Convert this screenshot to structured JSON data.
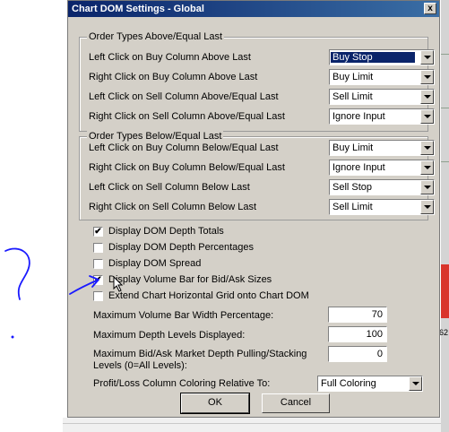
{
  "window": {
    "title": "Chart DOM Settings - Global",
    "close_label": "x"
  },
  "group_above": {
    "title": "Order Types Above/Equal Last",
    "rows": [
      {
        "label": "Left Click on Buy Column Above Last",
        "value": "Buy Stop",
        "selected": true
      },
      {
        "label": "Right Click on Buy Column Above Last",
        "value": "Buy Limit"
      },
      {
        "label": "Left Click on Sell Column Above/Equal Last",
        "value": "Sell Limit"
      },
      {
        "label": "Right Click on Sell Column Above/Equal Last",
        "value": "Ignore Input"
      }
    ]
  },
  "group_below": {
    "title": "Order Types Below/Equal Last",
    "rows": [
      {
        "label": "Left Click on Buy Column Below/Equal Last",
        "value": "Buy Limit"
      },
      {
        "label": "Right Click on Buy Column Below/Equal Last",
        "value": "Ignore Input"
      },
      {
        "label": "Left Click on Sell Column Below Last",
        "value": "Sell Stop"
      },
      {
        "label": "Right Click on Sell Column Below Last",
        "value": "Sell Limit"
      }
    ]
  },
  "checkboxes": [
    {
      "label": "Display DOM Depth Totals",
      "checked": true
    },
    {
      "label": "Display DOM Depth Percentages",
      "checked": false
    },
    {
      "label": "Display DOM Spread",
      "checked": false
    },
    {
      "label": "Display Volume Bar for Bid/Ask Sizes",
      "checked": true
    },
    {
      "label": "Extend Chart Horizontal Grid onto Chart DOM",
      "checked": false
    }
  ],
  "fields": [
    {
      "label": "Maximum Volume Bar Width Percentage:",
      "value": "70"
    },
    {
      "label": "Maximum Depth Levels Displayed:",
      "value": "100"
    },
    {
      "label_line1": "Maximum Bid/Ask Market Depth Pulling/Stacking",
      "label_line2": "Levels (0=All Levels):",
      "value": "0"
    }
  ],
  "coloring": {
    "label": "Profit/Loss Column Coloring Relative To:",
    "value": "Full Coloring"
  },
  "buttons": {
    "ok": "OK",
    "cancel": "Cancel"
  },
  "background": {
    "price_label": "62"
  },
  "colors": {
    "title_bar": "#0a246a",
    "dialog_bg": "#d4d0c8",
    "annotation_ink": "#1a1aff",
    "selection": "#0a246a"
  }
}
